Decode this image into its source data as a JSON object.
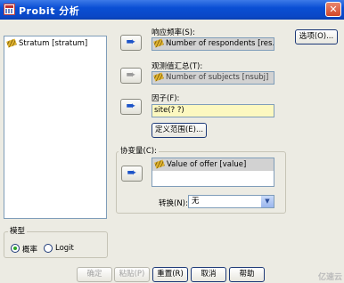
{
  "window": {
    "title": "Probit 分析",
    "close_glyph": "✕"
  },
  "source_list": {
    "items": [
      {
        "label": "Stratum [stratum]",
        "icon": "scale-ruler-icon"
      }
    ]
  },
  "arrow_glyph": "➨",
  "response_frequency": {
    "label": "响应频率(S):",
    "value": "Number of respondents [res..."
  },
  "observed_total": {
    "label": "观测值汇总(T):",
    "value": "Number of subjects [nsubj]"
  },
  "factor": {
    "label": "因子(F):",
    "value": "site(? ?)",
    "define_range_label": "定义范围(E)..."
  },
  "covariates": {
    "legend": "协变量(C):",
    "items": [
      {
        "label": "Value of offer [value]",
        "icon": "scale-ruler-icon"
      }
    ],
    "transform_label": "转换(N):",
    "transform_value": "无",
    "dropdown_glyph": "▼"
  },
  "options_label": "选项(O)...",
  "model": {
    "legend": "模型",
    "options": [
      {
        "label": "概率",
        "selected": true
      },
      {
        "label": "Logit",
        "selected": false
      }
    ]
  },
  "buttons": {
    "ok": "确定",
    "paste": "粘贴(P)",
    "reset": "重置(R)",
    "cancel": "取消",
    "help": "帮助"
  },
  "watermark": "亿速云"
}
